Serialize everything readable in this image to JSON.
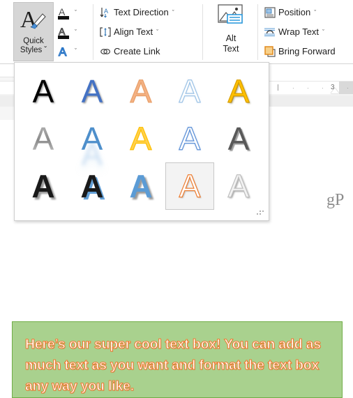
{
  "app": {
    "context": "Microsoft Word - Drawing Tools / Shape Format ribbon with WordArt Quick Styles gallery open"
  },
  "ribbon": {
    "quick_styles": {
      "icon": "wordart-brush-icon",
      "line1": "Quick",
      "line2": "Styles",
      "chevron": "ˇ",
      "state": "pressed"
    },
    "text_buttons": [
      {
        "icon": "text-fill-icon",
        "name": "text-fill",
        "glyph": "A",
        "chevron": "ˇ"
      },
      {
        "icon": "text-outline-icon",
        "name": "text-outline",
        "glyph": "A",
        "chevron": "ˇ"
      },
      {
        "icon": "text-effects-icon",
        "name": "text-effects",
        "glyph": "A",
        "chevron": "ˇ"
      }
    ],
    "text_group": [
      {
        "label": "Text Direction",
        "icon": "text-direction-icon",
        "chevron": "ˇ"
      },
      {
        "label": "Align Text",
        "icon": "align-text-icon",
        "chevron": "ˇ"
      },
      {
        "label": "Create Link",
        "icon": "create-link-icon",
        "chevron": ""
      }
    ],
    "alt_text": {
      "icon": "alt-text-picture-icon",
      "line1": "Alt",
      "line2": "Text"
    },
    "arrange_group": [
      {
        "label": "Position",
        "icon": "position-icon",
        "chevron": "ˇ"
      },
      {
        "label": "Wrap Text",
        "icon": "wrap-text-icon",
        "chevron": "ˇ"
      },
      {
        "label": "Bring Forward",
        "icon": "bring-forward-icon",
        "chevron": ""
      }
    ]
  },
  "ruler": {
    "number": "3",
    "tick_dot": "·",
    "tick_bar": "|",
    "indent_marker": "indent-marker"
  },
  "page": {
    "watermark": "gP"
  },
  "gallery": {
    "title": "WordArt Quick Styles gallery",
    "columns": 5,
    "rows": 3,
    "selected_index": 13,
    "grip": "resize-grip",
    "styles": [
      {
        "index": 0,
        "name": "fill-black-shadow",
        "glyph": "A",
        "fill": "#000000",
        "outline": "none",
        "effect": "shadow"
      },
      {
        "index": 1,
        "name": "fill-blue-shadow",
        "glyph": "A",
        "fill": "#4472C4",
        "outline": "none",
        "effect": "shadow"
      },
      {
        "index": 2,
        "name": "fill-peach-outline",
        "glyph": "A",
        "fill": "#F4B183",
        "outline": "#E8A06A",
        "effect": "soft-outline"
      },
      {
        "index": 3,
        "name": "outline-lightblue-hollow",
        "glyph": "A",
        "fill": "#FFFFFF",
        "outline": "#9DC3E6",
        "effect": "outline-glow"
      },
      {
        "index": 4,
        "name": "fill-gold-bevel",
        "glyph": "A",
        "fill": "#FFC000",
        "outline": "#D9A000",
        "effect": "bevel"
      },
      {
        "index": 5,
        "name": "fill-grey-gradient",
        "glyph": "A",
        "fill": "#9C9C9C",
        "outline": "none",
        "effect": "gradient"
      },
      {
        "index": 6,
        "name": "fill-blue-reflection",
        "glyph": "A",
        "fill": "#4E8FCB",
        "outline": "none",
        "effect": "reflection"
      },
      {
        "index": 7,
        "name": "fill-gold-outline",
        "glyph": "A",
        "fill": "#FFD04D",
        "outline": "#FFC000",
        "effect": "outline"
      },
      {
        "index": 8,
        "name": "outline-blue-hollow",
        "glyph": "A",
        "fill": "#FFFFFF",
        "outline": "#5B8FD6",
        "effect": "outline-glow"
      },
      {
        "index": 9,
        "name": "fill-darkgrey-bevel",
        "glyph": "A",
        "fill": "#595959",
        "outline": "none",
        "effect": "bevel-shadow"
      },
      {
        "index": 10,
        "name": "fill-black-bold-shadow",
        "glyph": "A",
        "fill": "#1A1A1A",
        "outline": "none",
        "effect": "drop-shadow"
      },
      {
        "index": 11,
        "name": "fill-black-blue-shadow",
        "glyph": "A",
        "fill": "#1A1A1A",
        "outline": "none",
        "effect": "blue-shadow"
      },
      {
        "index": 12,
        "name": "fill-blue-shadow-bold",
        "glyph": "A",
        "fill": "#5B9BD5",
        "outline": "none",
        "effect": "drop-shadow"
      },
      {
        "index": 13,
        "name": "outline-orange-hollow",
        "glyph": "A",
        "fill": "#FFFFFF",
        "outline": "#ED7D31",
        "effect": "outline-shadow"
      },
      {
        "index": 14,
        "name": "fill-white-grey-shadow",
        "glyph": "A",
        "fill": "#F2F2F2",
        "outline": "#BFBFBF",
        "effect": "shadow"
      }
    ]
  },
  "textbox": {
    "name": "document-text-box",
    "fill_color": "#A9D18E",
    "border_color": "#70AD47",
    "text_color": "#FFFFFF",
    "text_outline_color": "#ED7D31",
    "text": "Here’s our super cool text box! You can add as much text as you want and format the text box any way you like."
  }
}
